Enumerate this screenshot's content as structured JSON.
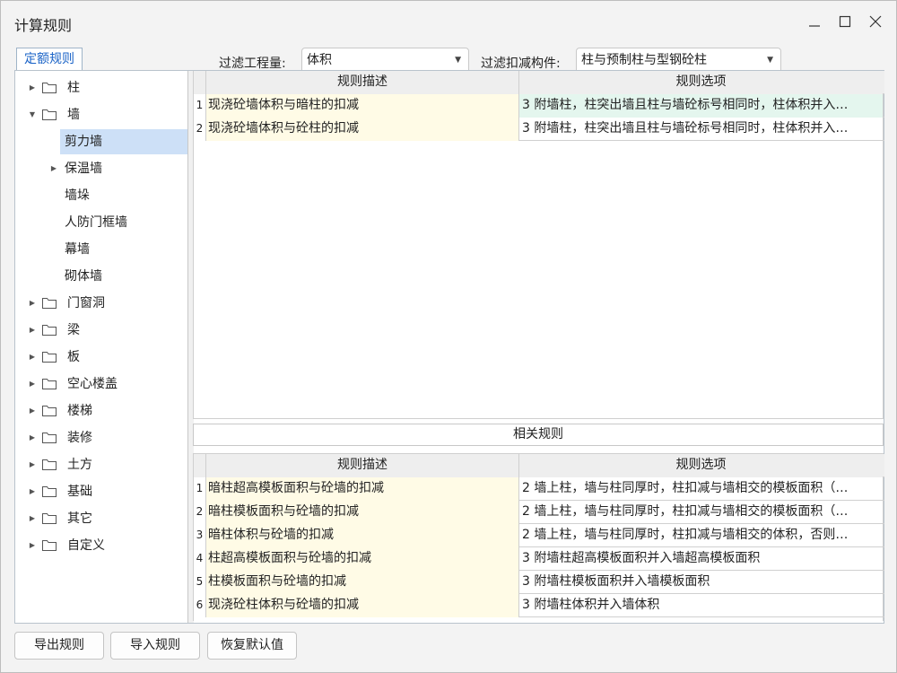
{
  "window": {
    "title": "计算规则"
  },
  "tab": {
    "label": "定额规则"
  },
  "filters": {
    "quantity_label": "过滤工程量:",
    "quantity_value": "体积",
    "component_label": "过滤扣减构件:",
    "component_value": "柱与预制柱与型钢砼柱"
  },
  "tree": {
    "items": [
      {
        "label": "柱"
      },
      {
        "label": "墙"
      },
      {
        "label": "剪力墙"
      },
      {
        "label": "保温墙"
      },
      {
        "label": "墙垛"
      },
      {
        "label": "人防门框墙"
      },
      {
        "label": "幕墙"
      },
      {
        "label": "砌体墙"
      },
      {
        "label": "门窗洞"
      },
      {
        "label": "梁"
      },
      {
        "label": "板"
      },
      {
        "label": "空心楼盖"
      },
      {
        "label": "楼梯"
      },
      {
        "label": "装修"
      },
      {
        "label": "土方"
      },
      {
        "label": "基础"
      },
      {
        "label": "其它"
      },
      {
        "label": "自定义"
      }
    ]
  },
  "rules_table": {
    "headers": {
      "desc": "规则描述",
      "option": "规则选项"
    },
    "rows": [
      {
        "idx": "1",
        "desc": "现浇砼墙体积与暗柱的扣减",
        "option": "3  附墙柱，柱突出墙且柱与墙砼标号相同时，柱体积并入…"
      },
      {
        "idx": "2",
        "desc": "现浇砼墙体积与砼柱的扣减",
        "option": "3  附墙柱，柱突出墙且柱与墙砼标号相同时，柱体积并入…"
      }
    ]
  },
  "related": {
    "title": "相关规则",
    "headers": {
      "desc": "规则描述",
      "option": "规则选项"
    },
    "rows": [
      {
        "idx": "1",
        "desc": "暗柱超高模板面积与砼墙的扣减",
        "option": "2 墙上柱，墙与柱同厚时，柱扣减与墙相交的模板面积（…"
      },
      {
        "idx": "2",
        "desc": "暗柱模板面积与砼墙的扣减",
        "option": "2 墙上柱，墙与柱同厚时，柱扣减与墙相交的模板面积（…"
      },
      {
        "idx": "3",
        "desc": "暗柱体积与砼墙的扣减",
        "option": "2 墙上柱，墙与柱同厚时，柱扣减与墙相交的体积，否则…"
      },
      {
        "idx": "4",
        "desc": "柱超高模板面积与砼墙的扣减",
        "option": "3 附墙柱超高模板面积并入墙超高模板面积"
      },
      {
        "idx": "5",
        "desc": "柱模板面积与砼墙的扣减",
        "option": "3 附墙柱模板面积并入墙模板面积"
      },
      {
        "idx": "6",
        "desc": "现浇砼柱体积与砼墙的扣减",
        "option": "3 附墙柱体积并入墙体积"
      }
    ]
  },
  "buttons": {
    "export": "导出规则",
    "import": "导入规则",
    "reset": "恢复默认值"
  },
  "colors": {
    "accent": "#1a63c7",
    "selected_bg": "#cde0f7",
    "desc_bg": "#fffbe6",
    "highlight_bg": "#e4f6ee"
  }
}
